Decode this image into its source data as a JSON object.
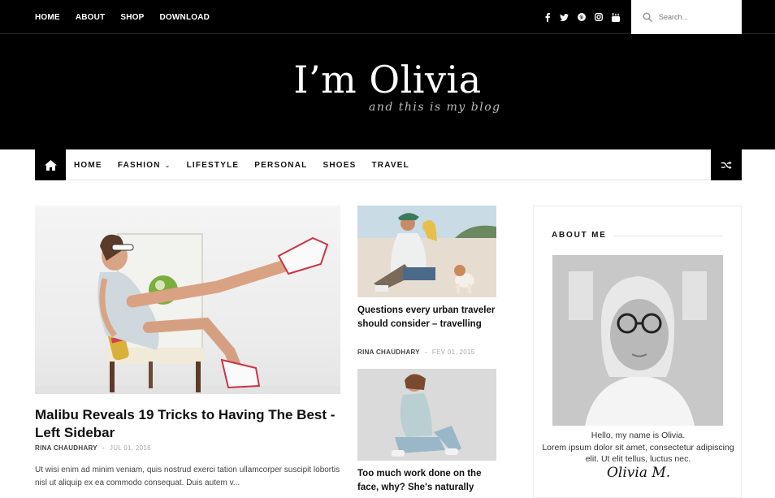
{
  "topbar": {
    "nav": [
      "HOME",
      "ABOUT",
      "SHOP",
      "DOWNLOAD"
    ],
    "social_icons": [
      "facebook-icon",
      "twitter-icon",
      "pinterest-icon",
      "instagram-icon",
      "youtube-icon"
    ],
    "search_placeholder": "Search..."
  },
  "header": {
    "title": "I’m Olivia",
    "tagline": "and this is my blog"
  },
  "mainnav": {
    "items": [
      "HOME",
      "FASHION",
      "LIFESTYLE",
      "PERSONAL",
      "SHOES",
      "TRAVEL"
    ]
  },
  "featured": {
    "title": "Malibu Reveals 19 Tricks to Having The Best - Left Sidebar",
    "author": "RINA CHAUDHARY",
    "date": "JUL 01, 2016",
    "excerpt": "Ut wisi enim ad minim veniam, quis nostrud exerci tation ullamcorper suscipit lobortis nisl ut aliquip ex ea commodo consequat. Duis autem v..."
  },
  "cards": [
    {
      "title": "Questions every urban traveler should consider – travelling",
      "author": "RINA CHAUDHARY",
      "date": "FEV 01, 2015"
    },
    {
      "title": "Too much work done on the face, why? She's naturally"
    }
  ],
  "about": {
    "heading": "ABOUT ME",
    "line1": "Hello, my name is Olivia.",
    "line2": "Lorem ipsum dolor sit amet, consectetur adipiscing elit. Ut elit tellus, luctus nec.",
    "signature": "Olivia M."
  },
  "colors": {
    "header_bg": "#000000",
    "accent_dash": "#e05a5a"
  }
}
